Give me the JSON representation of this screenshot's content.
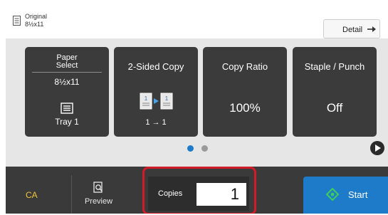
{
  "header": {
    "original_label": "Original",
    "original_size": "8½x11",
    "detail_label": "Detail"
  },
  "tiles": [
    {
      "key": "paper-select",
      "title_line1": "Paper",
      "title_line2": "Select",
      "size": "8½x11",
      "tray": "Tray 1"
    },
    {
      "key": "two-sided-copy",
      "title": "2-Sided Copy",
      "value": "1 → 1"
    },
    {
      "key": "copy-ratio",
      "title": "Copy Ratio",
      "value": "100%"
    },
    {
      "key": "staple-punch",
      "title": "Staple / Punch",
      "value": "Off"
    }
  ],
  "pager": {
    "pages": 2,
    "active_page": 1,
    "active_color": "#1e7bc9",
    "inactive_color": "#9a9a9a"
  },
  "bottom": {
    "ca_label": "CA",
    "preview_label": "Preview",
    "copies_label": "Copies",
    "copies_value": "1",
    "start_label": "Start"
  },
  "colors": {
    "tile_bg": "#3b3b3b",
    "ca_text": "#f0c53c",
    "start_bg": "#1e7bc9",
    "start_icon": "#3fce5a",
    "highlight": "#d11a2a"
  },
  "icons": {
    "original": "document-lines-icon",
    "detail": "arrow-right-icon",
    "tray": "tray-icon",
    "duplex": "duplex-pages-icon",
    "next": "chevron-right-icon",
    "preview": "magnifier-document-icon",
    "start": "diamond-start-icon"
  }
}
